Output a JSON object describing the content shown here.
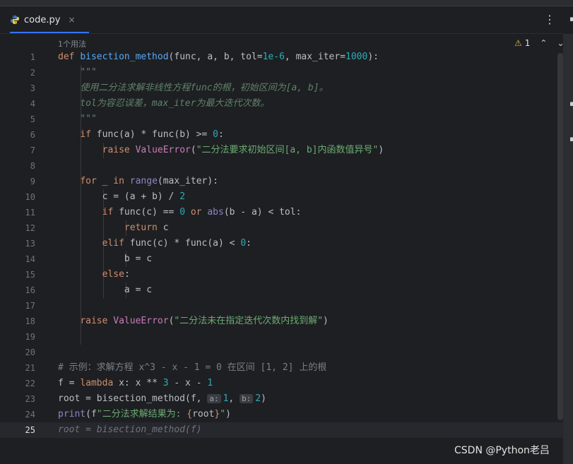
{
  "tab": {
    "title": "code.py",
    "close": "×",
    "menu": "⋮"
  },
  "editor": {
    "usages": "1个用法",
    "warning_count": "1",
    "param_hints": {
      "a": "a:",
      "b": "b:"
    }
  },
  "line_numbers": [
    "1",
    "2",
    "3",
    "4",
    "5",
    "6",
    "7",
    "8",
    "9",
    "10",
    "11",
    "12",
    "13",
    "14",
    "15",
    "16",
    "17",
    "18",
    "19",
    "20",
    "21",
    "22",
    "23",
    "24",
    "25"
  ],
  "code": {
    "l1": {
      "kw": "def",
      "fn": "bisection_method",
      "args_a": "(func, a, b, tol=",
      "num1": "1e-6",
      "args_b": ", max_iter=",
      "num2": "1000",
      "end": "):"
    },
    "l2": "\"\"\"",
    "l3": "使用二分法求解非线性方程func的根，初始区间为[a, b]。",
    "l4": "tol为容忍误差，max_iter为最大迭代次数。",
    "l5": "\"\"\"",
    "l6": {
      "kw": "if",
      "a": " func(a) * func(b) >= ",
      "num": "0",
      "end": ":"
    },
    "l7": {
      "kw": "raise",
      "cls": "ValueError",
      "open": "(",
      "str": "\"二分法要求初始区间[a, b]内函数值异号\"",
      "close": ")"
    },
    "l9": {
      "kw1": "for",
      "a": " _ ",
      "kw2": "in",
      "bi": "range",
      "end": "(max_iter):"
    },
    "l10": {
      "a": "c = (a + b) / ",
      "num": "2"
    },
    "l11": {
      "kw": "if",
      "a": " func(c) == ",
      "num": "0",
      "kw2": "or",
      "bi": "abs",
      "end": "(b - a) < tol:"
    },
    "l12": {
      "kw": "return",
      "a": " c"
    },
    "l13": {
      "kw": "elif",
      "a": " func(c) * func(a) < ",
      "num": "0",
      "end": ":"
    },
    "l14": "b = c",
    "l15": {
      "kw": "else",
      "end": ":"
    },
    "l16": "a = c",
    "l18": {
      "kw": "raise",
      "cls": "ValueError",
      "open": "(",
      "str": "\"二分法未在指定迭代次数内找到解\"",
      "close": ")"
    },
    "l21": "# 示例：求解方程 x^3 - x - 1 = 0 在区间 [1, 2] 上的根",
    "l22": {
      "a": "f = ",
      "kw": "lambda",
      "b": " x: x ** ",
      "num1": "3",
      "c": " - x - ",
      "num2": "1"
    },
    "l23": {
      "a": "root = bisection_method(f, ",
      "num1": "1",
      "mid": ", ",
      "num2": "2",
      "end": ")"
    },
    "l24": {
      "bi": "print",
      "open": "(f",
      "str1": "\"二分法求解结果为: ",
      "brace_open": "{",
      "mid": "root",
      "brace_close": "}",
      "str2": "\"",
      "close": ")"
    },
    "l25": "root = bisection_method(f)"
  },
  "watermark": "CSDN @Python老吕",
  "colors": {
    "background": "#1e1f22",
    "keyword": "#cf8e6d",
    "function": "#56a8f5",
    "number": "#2aacb8",
    "string": "#6aab73",
    "docstring": "#5f826b",
    "accent": "#3574f0"
  }
}
